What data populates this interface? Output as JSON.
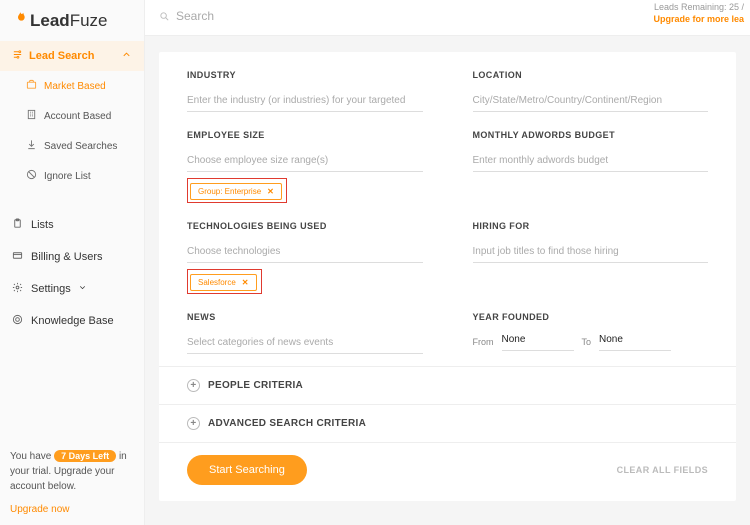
{
  "brand": {
    "lead": "Lead",
    "fuze": "Fuze"
  },
  "topbar": {
    "search_placeholder": "Search",
    "leads_remaining": "Leads Remaining: 25 /",
    "upgrade_more": "Upgrade for more lea"
  },
  "sidebar": {
    "lead_search": "Lead Search",
    "items": [
      {
        "label": "Market Based"
      },
      {
        "label": "Account Based"
      },
      {
        "label": "Saved Searches"
      },
      {
        "label": "Ignore List"
      }
    ],
    "top": [
      {
        "label": "Lists"
      },
      {
        "label": "Billing & Users"
      },
      {
        "label": "Settings"
      },
      {
        "label": "Knowledge Base"
      }
    ]
  },
  "trial": {
    "prefix": "You have",
    "pill": "7 Days Left",
    "suffix": "in your trial. Upgrade your account below.",
    "link": "Upgrade now"
  },
  "form": {
    "industry": {
      "label": "INDUSTRY",
      "placeholder": "Enter the industry (or industries) for your targeted"
    },
    "location": {
      "label": "LOCATION",
      "placeholder": "City/State/Metro/Country/Continent/Region"
    },
    "employee": {
      "label": "EMPLOYEE SIZE",
      "placeholder": "Choose employee size range(s)",
      "chip": "Group: Enterprise"
    },
    "adwords": {
      "label": "MONTHLY ADWORDS BUDGET",
      "placeholder": "Enter monthly adwords budget"
    },
    "tech": {
      "label": "TECHNOLOGIES BEING USED",
      "placeholder": "Choose technologies",
      "chip": "Salesforce"
    },
    "hiring": {
      "label": "HIRING FOR",
      "placeholder": "Input job titles to find those hiring"
    },
    "news": {
      "label": "NEWS",
      "placeholder": "Select categories of news events"
    },
    "year": {
      "label": "YEAR FOUNDED",
      "from_label": "From",
      "from_value": "None",
      "to_label": "To",
      "to_value": "None"
    },
    "people": "PEOPLE CRITERIA",
    "advanced": "ADVANCED SEARCH CRITERIA",
    "start": "Start Searching",
    "clear": "CLEAR ALL FIELDS"
  }
}
